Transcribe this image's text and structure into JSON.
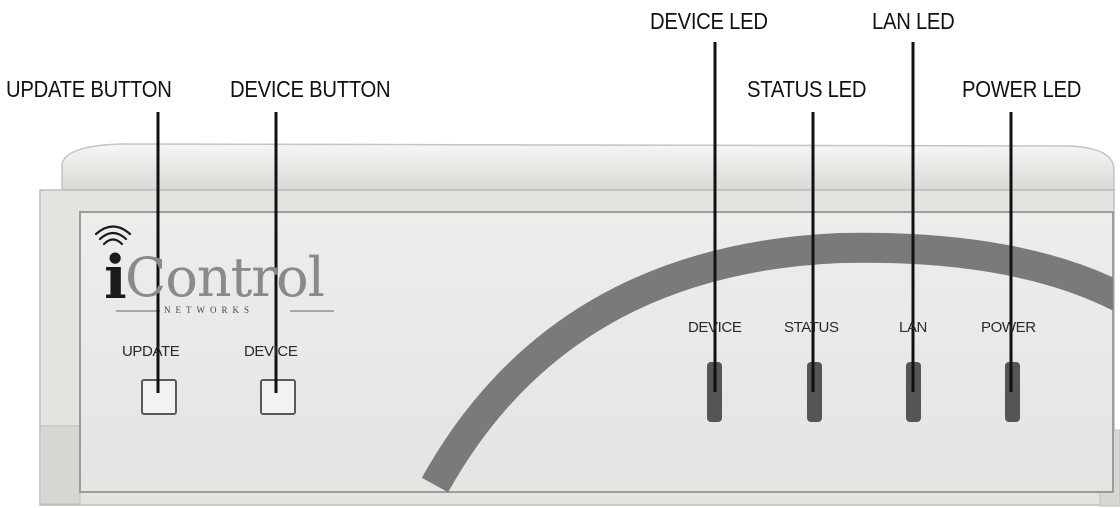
{
  "callouts": {
    "update_button": "UPDATE BUTTON",
    "device_button": "DEVICE BUTTON",
    "device_led": "DEVICE LED",
    "status_led": "STATUS LED",
    "lan_led": "LAN LED",
    "power_led": "POWER LED"
  },
  "brand": {
    "logo_i": "i",
    "logo_rest": "Control",
    "logo_sub": "NETWORKS"
  },
  "panel_labels": {
    "update": "UPDATE",
    "device_btn": "DEVICE",
    "device_led": "DEVICE",
    "status_led": "STATUS",
    "lan_led": "LAN",
    "power_led": "POWER"
  },
  "colors": {
    "device_body": "#e8e8e6",
    "front_panel": "#ececea",
    "arc": "#7a7a7a",
    "led": "#555555",
    "button": "#efefed"
  }
}
